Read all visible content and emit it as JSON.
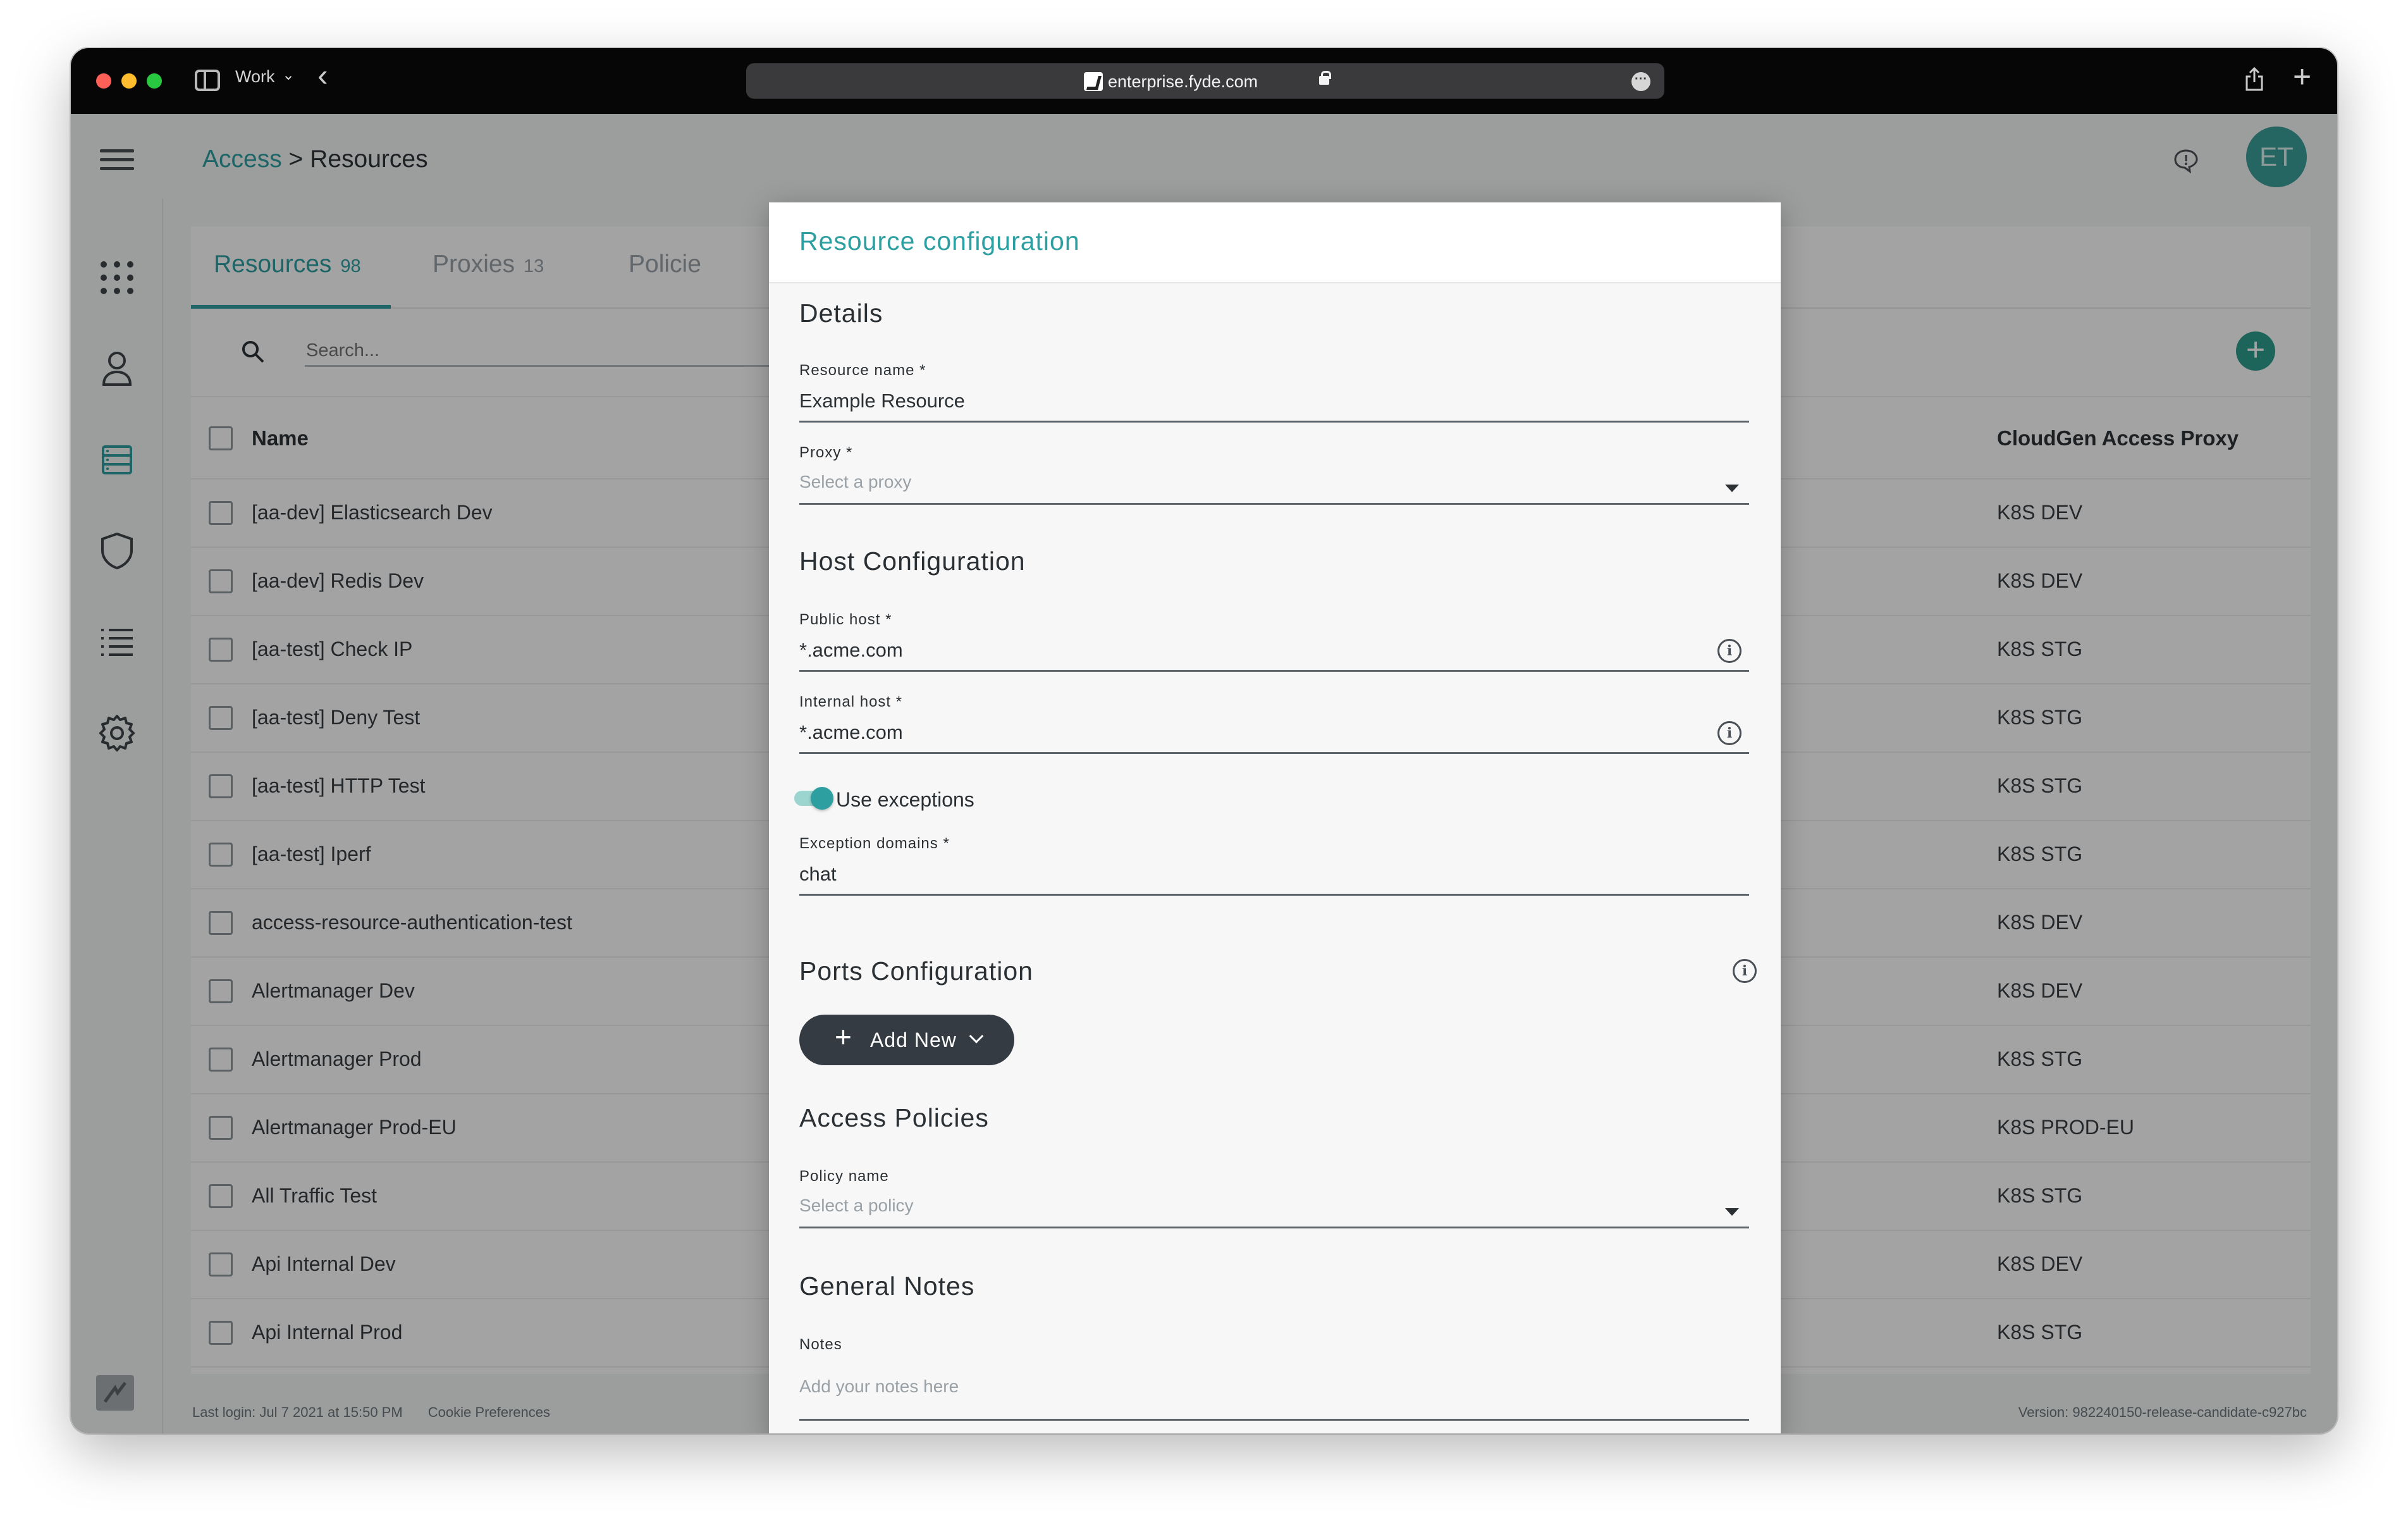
{
  "browser": {
    "profile_label": "Work",
    "url": "enterprise.fyde.com"
  },
  "header": {
    "breadcrumb_link": "Access",
    "breadcrumb_sep": " > ",
    "breadcrumb_current": "Resources",
    "avatar_initials": "ET"
  },
  "tabs": [
    {
      "label": "Resources",
      "count": "98"
    },
    {
      "label": "Proxies",
      "count": "13"
    },
    {
      "label": "Policie",
      "count": ""
    }
  ],
  "search": {
    "placeholder": "Search..."
  },
  "table": {
    "col_name": "Name",
    "col_proxy": "CloudGen Access Proxy",
    "rows": [
      {
        "name": "[aa-dev] Elasticsearch Dev",
        "proxy": "K8S DEV"
      },
      {
        "name": "[aa-dev] Redis Dev",
        "proxy": "K8S DEV"
      },
      {
        "name": "[aa-test] Check IP",
        "proxy": "K8S STG"
      },
      {
        "name": "[aa-test] Deny Test",
        "proxy": "K8S STG"
      },
      {
        "name": "[aa-test] HTTP Test",
        "proxy": "K8S STG"
      },
      {
        "name": "[aa-test] Iperf",
        "proxy": "K8S STG"
      },
      {
        "name": "access-resource-authentication-test",
        "proxy": "K8S DEV"
      },
      {
        "name": "Alertmanager Dev",
        "proxy": "K8S DEV"
      },
      {
        "name": "Alertmanager Prod",
        "proxy": "K8S STG"
      },
      {
        "name": "Alertmanager Prod-EU",
        "proxy": "K8S PROD-EU"
      },
      {
        "name": "All Traffic Test",
        "proxy": "K8S STG"
      },
      {
        "name": "Api Internal Dev",
        "proxy": "K8S DEV"
      },
      {
        "name": "Api Internal Prod",
        "proxy": "K8S STG"
      }
    ]
  },
  "footer": {
    "last_login": "Last login: Jul 7 2021 at 15:50 PM",
    "cookie": "Cookie Preferences",
    "version": "Version: 982240150-release-candidate-c927bc"
  },
  "modal": {
    "title": "Resource configuration",
    "details_title": "Details",
    "resource_name_label": "Resource name *",
    "resource_name_value": "Example Resource",
    "proxy_label": "Proxy *",
    "proxy_placeholder": "Select a proxy",
    "host_title": "Host Configuration",
    "public_host_label": "Public host *",
    "public_host_value": "*.acme.com",
    "internal_host_label": "Internal host *",
    "internal_host_value": "*.acme.com",
    "use_exceptions_label": "Use exceptions",
    "use_exceptions_on": true,
    "exception_domains_label": "Exception domains *",
    "exception_domains_value": "chat",
    "ports_title": "Ports Configuration",
    "add_new_label": "Add New",
    "access_title": "Access Policies",
    "policy_label": "Policy name",
    "policy_placeholder": "Select a policy",
    "notes_title": "General Notes",
    "notes_label": "Notes",
    "notes_placeholder": "Add your notes here"
  },
  "colors": {
    "accent": "#2e9fa0",
    "button_dark": "#343b42",
    "overlay": "rgba(0,0,0,0.36)"
  }
}
